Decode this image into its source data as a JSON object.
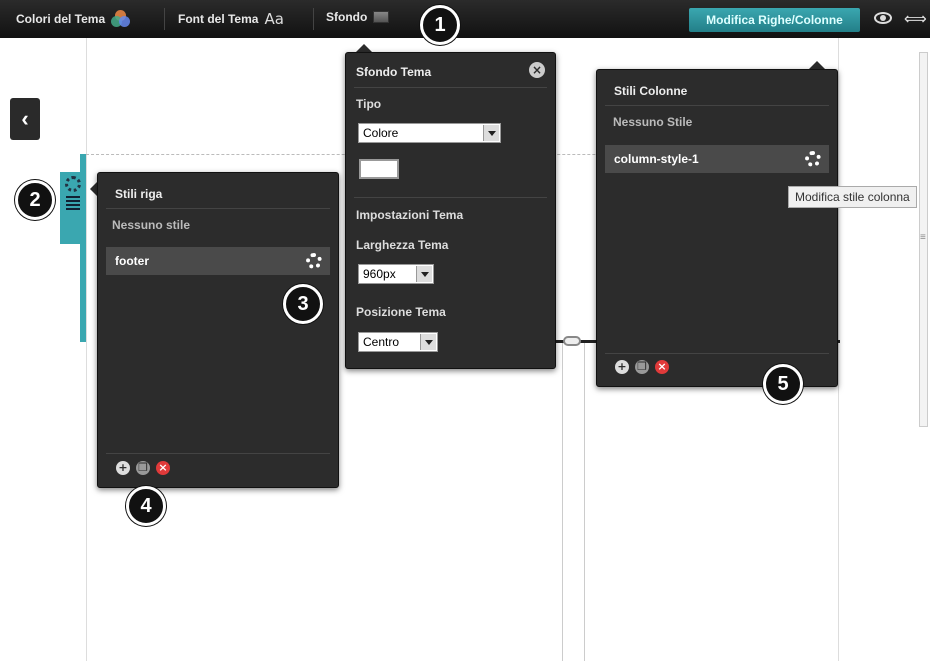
{
  "toolbar": {
    "colors_label": "Colori del Tema",
    "fonts_label": "Font del Tema",
    "fonts_glyph": "Aa",
    "background_label": "Sfondo",
    "edit_button": "Modifica Righe/Colonne"
  },
  "background_panel": {
    "title": "Sfondo Tema",
    "type_label": "Tipo",
    "type_value": "Colore",
    "color_value": "#ffffff",
    "settings_heading": "Impostazioni Tema",
    "width_label": "Larghezza Tema",
    "width_value": "960px",
    "position_label": "Posizione Tema",
    "position_value": "Centro"
  },
  "row_panel": {
    "title": "Stili riga",
    "none_label": "Nessuno stile",
    "items": [
      {
        "label": "footer"
      }
    ]
  },
  "column_panel": {
    "title": "Stili Colonne",
    "none_label": "Nessuno Stile",
    "items": [
      {
        "label": "column-style-1"
      }
    ]
  },
  "tooltip": "Modifica stile colonna",
  "callouts": [
    "1",
    "2",
    "3",
    "4",
    "5"
  ],
  "colors": {
    "accent": "#3aa7b0",
    "panel": "#2c2c2c",
    "delete": "#e03a3a"
  }
}
